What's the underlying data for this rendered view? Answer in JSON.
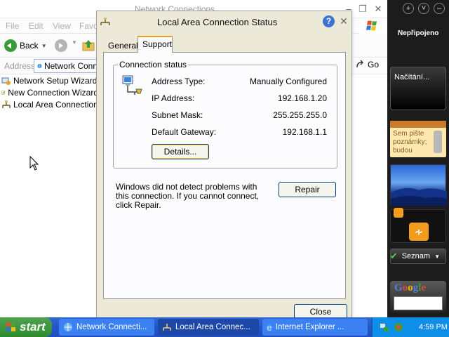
{
  "explorer": {
    "title": "Network Connections",
    "menu": [
      "File",
      "Edit",
      "View",
      "Favo"
    ],
    "back_label": "Back",
    "address_label": "Address",
    "address_value": "Network Conn",
    "go_label": "Go",
    "items": [
      {
        "label": "Network Setup Wizard",
        "icon": "network-setup-wizard-icon"
      },
      {
        "label": "New Connection Wizard",
        "icon": "new-connection-wizard-icon"
      },
      {
        "label": "Local Area Connection",
        "icon": "lan-connection-icon"
      }
    ]
  },
  "dialog": {
    "title": "Local Area Connection Status",
    "tabs": [
      "General",
      "Support"
    ],
    "active_tab": "Support",
    "group_label": "Connection status",
    "rows": [
      {
        "label": "Address Type:",
        "value": "Manually Configured"
      },
      {
        "label": "IP Address:",
        "value": "192.168.1.20"
      },
      {
        "label": "Subnet Mask:",
        "value": "255.255.255.0"
      },
      {
        "label": "Default Gateway:",
        "value": "192.168.1.1"
      }
    ],
    "details_label": "Details...",
    "diagnostic_text": "Windows did not detect problems with this connection. If you cannot connect, click Repair.",
    "repair_label": "Repair",
    "close_label": "Close"
  },
  "sidebar": {
    "status": "Nepřipojeno",
    "loading_text": "Načítání...",
    "notes_text": "Sem pište poznámky; budou",
    "seznam_label": "Seznam",
    "google_label": "Google"
  },
  "taskbar": {
    "start_label": "start",
    "tasks": [
      {
        "label": "Network Connecti...",
        "active": false
      },
      {
        "label": "Local Area Connec...",
        "active": true
      },
      {
        "label": "Internet Explorer ...",
        "active": false
      }
    ],
    "clock": "4:59 PM"
  },
  "colors": {
    "taskbar_blue": "#2457c8",
    "start_green": "#3c9a3c",
    "dialog_face": "#ece9d8",
    "tab_accent": "#e8a11c",
    "sidebar_bg": "#1c1c1c",
    "feed_orange": "#f29b1d"
  }
}
